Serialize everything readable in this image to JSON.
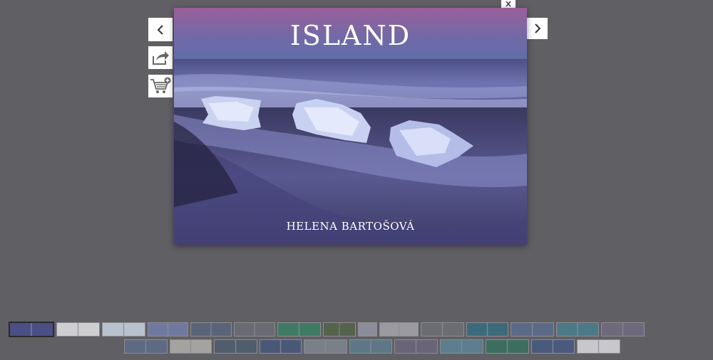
{
  "viewer": {
    "title": "ISLAND",
    "author": "HELENA BARTOŠOVÁ"
  },
  "controls": {
    "prev_icon": "chevron-left-icon",
    "next_icon": "chevron-right-icon",
    "share_icon": "share-icon",
    "cart_icon": "cart-add-icon",
    "close_icon": "close-icon"
  },
  "colors": {
    "background": "#605f64",
    "sky_top": "#7a5a8c",
    "sea": "#5a5f9a",
    "sand": "#2c2a45"
  },
  "thumbnails": {
    "row1": [
      {
        "tone": "#4a4f86",
        "active": true
      },
      {
        "tone": "#cfcfd2"
      },
      {
        "tone": "#b9c3cf"
      },
      {
        "tone": "#6f79a0"
      },
      {
        "tone": "#5a6478"
      },
      {
        "tone": "#6a6a72"
      },
      {
        "tone": "#3f7a64"
      },
      {
        "tone": "#55624c"
      },
      {
        "tone": "#8b8e9a"
      },
      {
        "tone": "#9a9aa0"
      },
      {
        "tone": "#6b6d73"
      },
      {
        "tone": "#3b6b7a"
      },
      {
        "tone": "#5a6a88"
      },
      {
        "tone": "#4b7a86"
      },
      {
        "tone": "#6e6a7c"
      }
    ],
    "row2": [
      {
        "tone": "#5d6a84"
      },
      {
        "tone": "#a5a3a0"
      },
      {
        "tone": "#4f5d6c"
      },
      {
        "tone": "#4a5878"
      },
      {
        "tone": "#7a8088"
      },
      {
        "tone": "#5d7786"
      },
      {
        "tone": "#6a6478"
      },
      {
        "tone": "#5c7e8e"
      },
      {
        "tone": "#3c6e5e"
      },
      {
        "tone": "#4a5a7c"
      },
      {
        "tone": "#c8c8cc"
      }
    ]
  }
}
